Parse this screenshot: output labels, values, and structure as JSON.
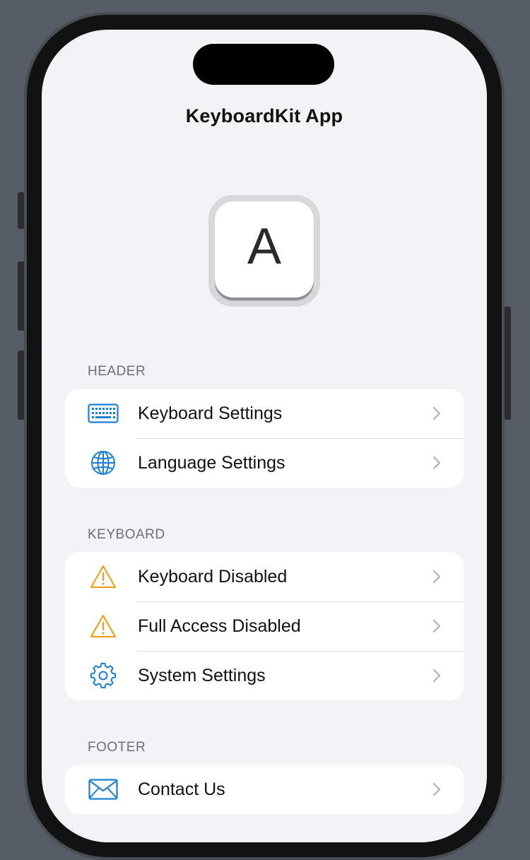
{
  "nav": {
    "title": "KeyboardKit App"
  },
  "app_icon": {
    "letter": "A"
  },
  "sections": [
    {
      "header": "HEADER",
      "items": [
        {
          "label": "Keyboard Settings",
          "icon": "keyboard-icon"
        },
        {
          "label": "Language Settings",
          "icon": "globe-icon"
        }
      ]
    },
    {
      "header": "KEYBOARD",
      "items": [
        {
          "label": "Keyboard Disabled",
          "icon": "warning-icon"
        },
        {
          "label": "Full Access Disabled",
          "icon": "warning-icon"
        },
        {
          "label": "System Settings",
          "icon": "gear-icon"
        }
      ]
    },
    {
      "header": "FOOTER",
      "items": [
        {
          "label": "Contact Us",
          "icon": "envelope-icon"
        }
      ]
    }
  ],
  "colors": {
    "accent": "#1a7fd8",
    "warning": "#f0a020",
    "background": "#f2f2f7",
    "card": "#ffffff",
    "separator": "#dcdce0",
    "chevron": "#b8b8bd"
  }
}
